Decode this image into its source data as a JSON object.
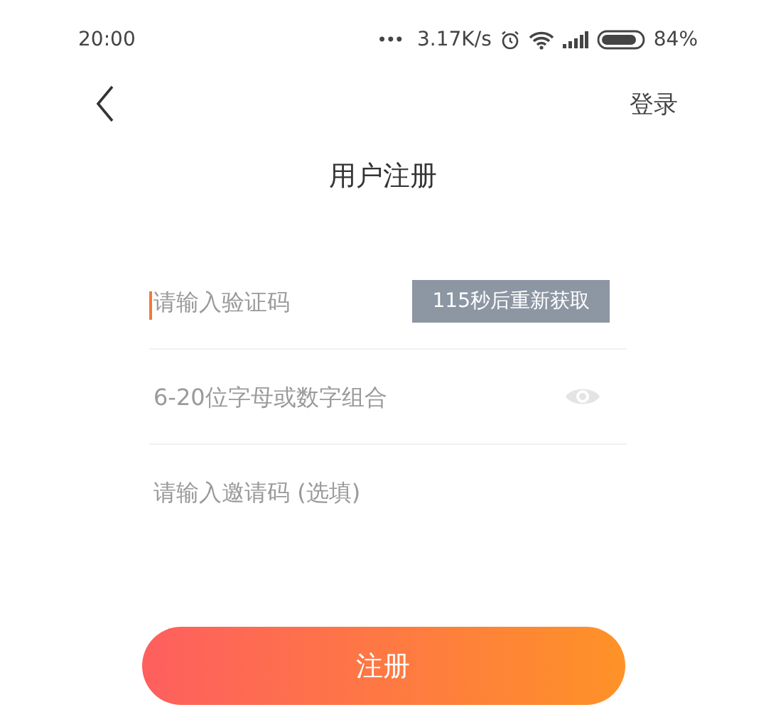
{
  "status_bar": {
    "time": "20:00",
    "more": "•••",
    "network_speed": "3.17K/s",
    "battery": "84%"
  },
  "nav": {
    "action": "登录"
  },
  "title": "用户注册",
  "fields": [
    {
      "kind": "code",
      "placeholder": "请输入验证码",
      "focused": true,
      "action": {
        "label": "115秒后重新获取",
        "disabled": true
      }
    },
    {
      "kind": "password",
      "placeholder": "6-20位字母或数字组合",
      "focused": false
    },
    {
      "kind": "text",
      "placeholder": "请输入邀请码 (选填)",
      "focused": false
    }
  ],
  "submit_button": {
    "label": "注册"
  }
}
